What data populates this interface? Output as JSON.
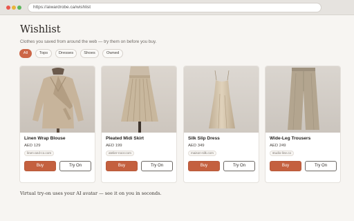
{
  "browser": {
    "url": "https://aiwardrobe.ca/wishlist"
  },
  "header": {
    "title": "Wishlist",
    "subtitle": "Clothes you saved from around the web — try them on before you buy."
  },
  "filters": [
    {
      "label": "All",
      "active": true
    },
    {
      "label": "Tops",
      "active": false
    },
    {
      "label": "Dresses",
      "active": false
    },
    {
      "label": "Shoes",
      "active": false
    },
    {
      "label": "Owned",
      "active": false
    }
  ],
  "products": [
    {
      "name": "Linen Wrap Blouse",
      "price": "AED 129",
      "store": "linen-and-co.com",
      "image_icon": "blouse-photo",
      "buy_label": "Buy",
      "tryon_label": "Try On"
    },
    {
      "name": "Pleated Midi Skirt",
      "price": "AED 199",
      "store": "atelier-noor.com",
      "image_icon": "skirt-photo",
      "buy_label": "Buy",
      "tryon_label": "Try On"
    },
    {
      "name": "Silk Slip Dress",
      "price": "AED 349",
      "store": "maison-silk.com",
      "image_icon": "dress-photo",
      "buy_label": "Buy",
      "tryon_label": "Try On"
    },
    {
      "name": "Wide-Leg Trousers",
      "price": "AED 249",
      "store": "studio-line.co",
      "image_icon": "trousers-photo",
      "buy_label": "Buy",
      "tryon_label": "Try On"
    }
  ],
  "footer": {
    "text": "Virtual try-on uses your AI avatar — see it on you in seconds."
  },
  "colors": {
    "accent": "#c4603f",
    "background": "#f7f5f2",
    "card": "#ffffff"
  }
}
